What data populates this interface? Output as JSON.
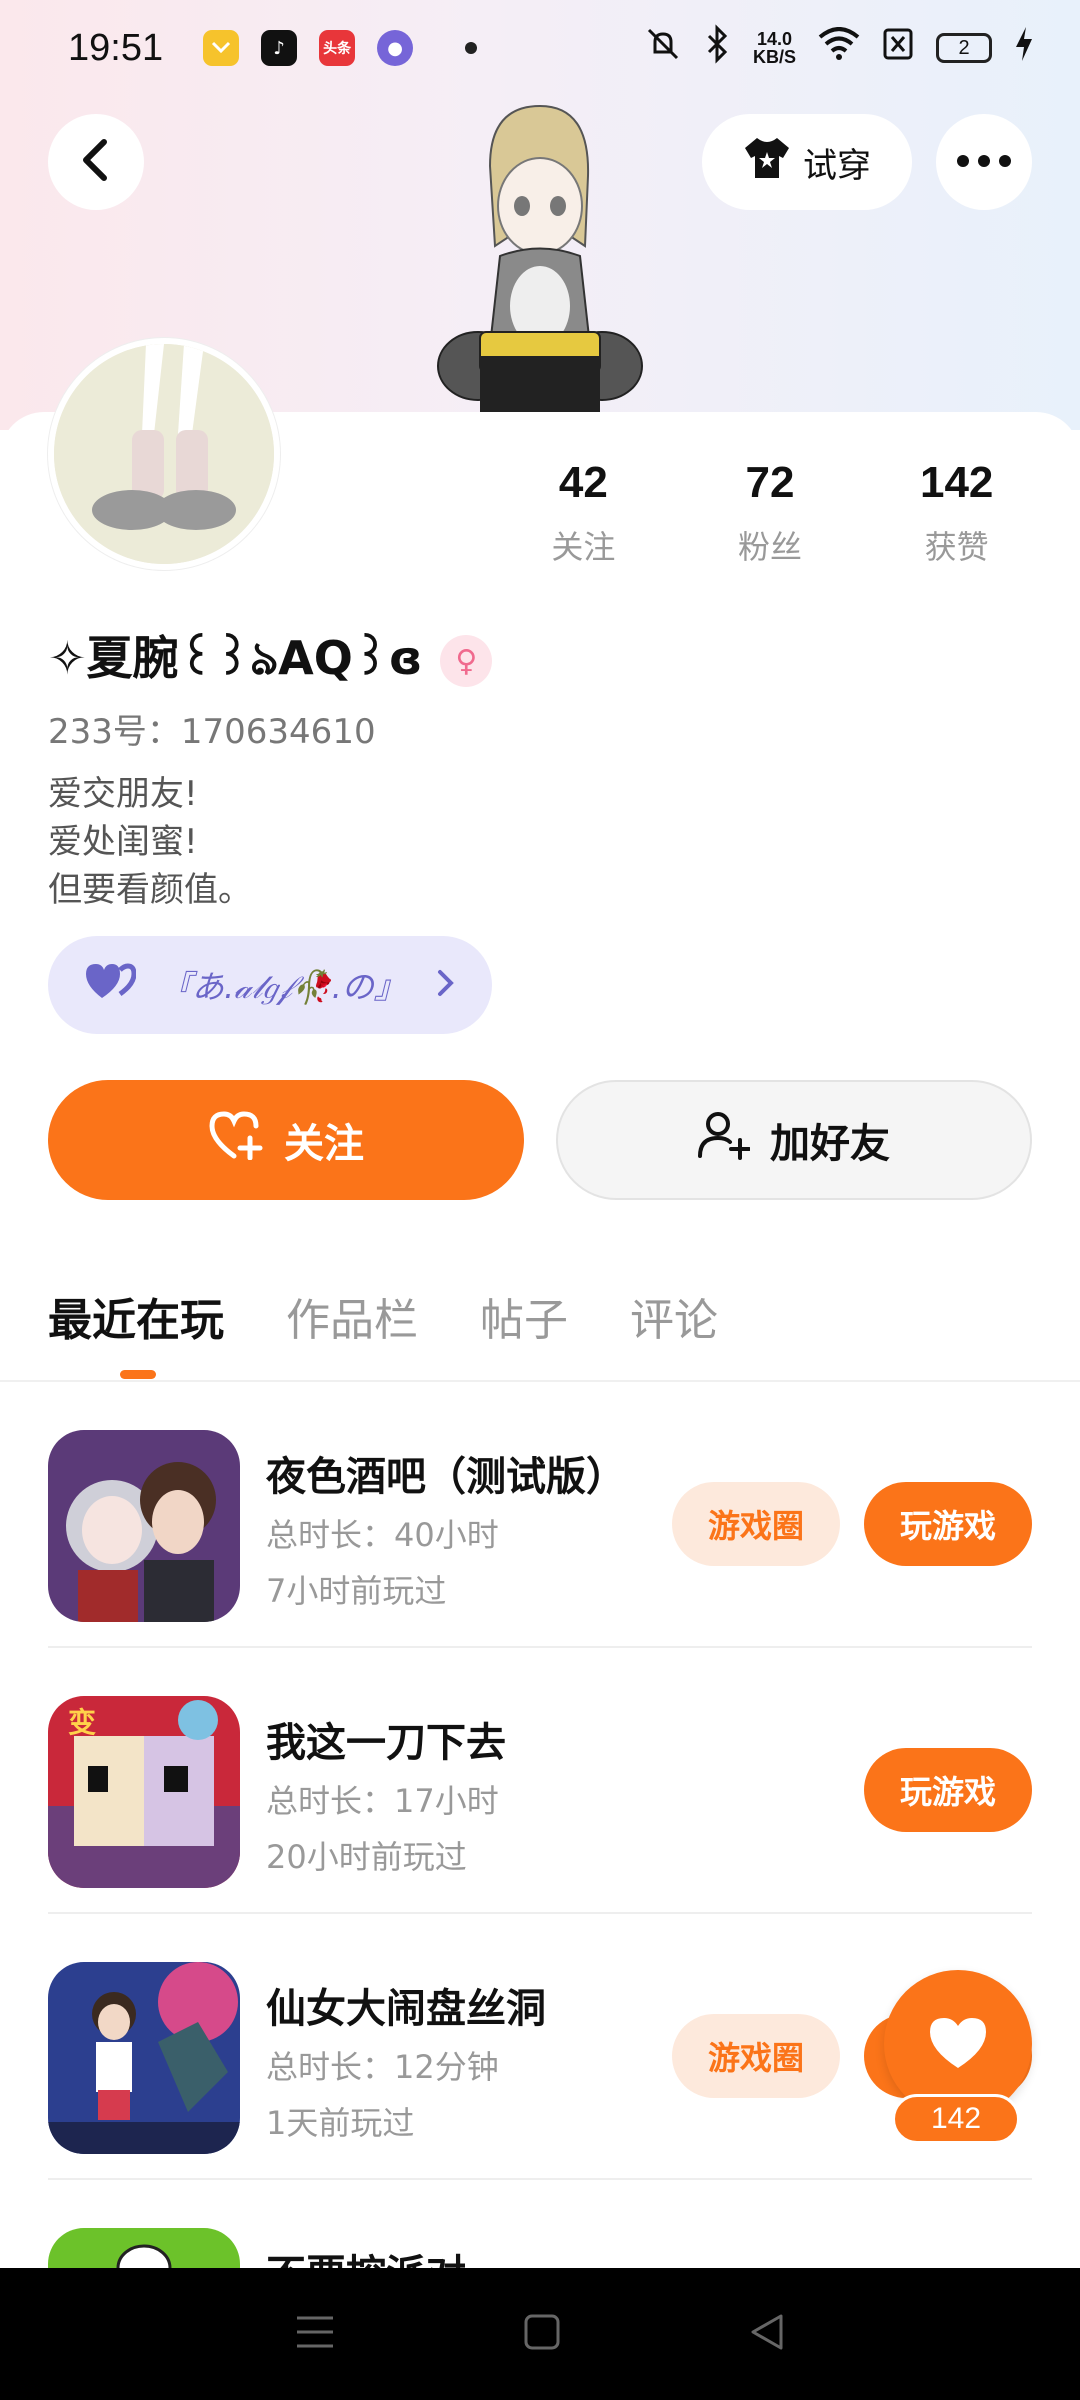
{
  "status_bar": {
    "time": "19:51",
    "net_speed_value": "14.0",
    "net_speed_unit": "KB/S",
    "battery": "2",
    "app_icons": [
      "video-app-icon",
      "tiktok-icon",
      "toutiao-icon",
      "browser-icon"
    ],
    "toutiao_label": "头条"
  },
  "header": {
    "try_on_label": "试穿"
  },
  "profile": {
    "following_count": "42",
    "following_label": "关注",
    "fans_count": "72",
    "fans_label": "粉丝",
    "likes_count": "142",
    "likes_label": "获赞",
    "name": "✧夏腕꒰꒱ঌAQ꒱ɞ",
    "gender_symbol": "♀",
    "uid": "233号：170634610",
    "bio": [
      "爱交朋友!",
      "爱处闺蜜!",
      "但要看颜值。"
    ],
    "group_tag": "『あ.𝒶𝓁𝑔𝒻🥀.の』"
  },
  "actions": {
    "follow_label": "关注",
    "add_friend_label": "加好友"
  },
  "tabs": [
    {
      "label": "最近在玩",
      "active": true
    },
    {
      "label": "作品栏",
      "active": false
    },
    {
      "label": "帖子",
      "active": false
    },
    {
      "label": "评论",
      "active": false
    }
  ],
  "games": [
    {
      "title": "夜色酒吧（测试版）",
      "duration": "总时长：40小时",
      "last_played": "7小时前玩过",
      "circle_label": "游戏圈",
      "play_label": "玩游戏"
    },
    {
      "title": "我这一刀下去",
      "duration": "总时长：17小时",
      "last_played": "20小时前玩过",
      "play_label": "玩游戏"
    },
    {
      "title": "仙女大闹盘丝洞",
      "duration": "总时长：12分钟",
      "last_played": "1天前玩过",
      "circle_label": "游戏圈",
      "play_label": "玩游戏"
    },
    {
      "title": "不要控派对"
    }
  ],
  "fab": {
    "like_count": "142"
  },
  "colors": {
    "accent": "#fb7419",
    "accent_light": "#fde9dc",
    "group_pill_bg": "#e9e8fb",
    "group_pill_fg": "#6a65c8"
  }
}
